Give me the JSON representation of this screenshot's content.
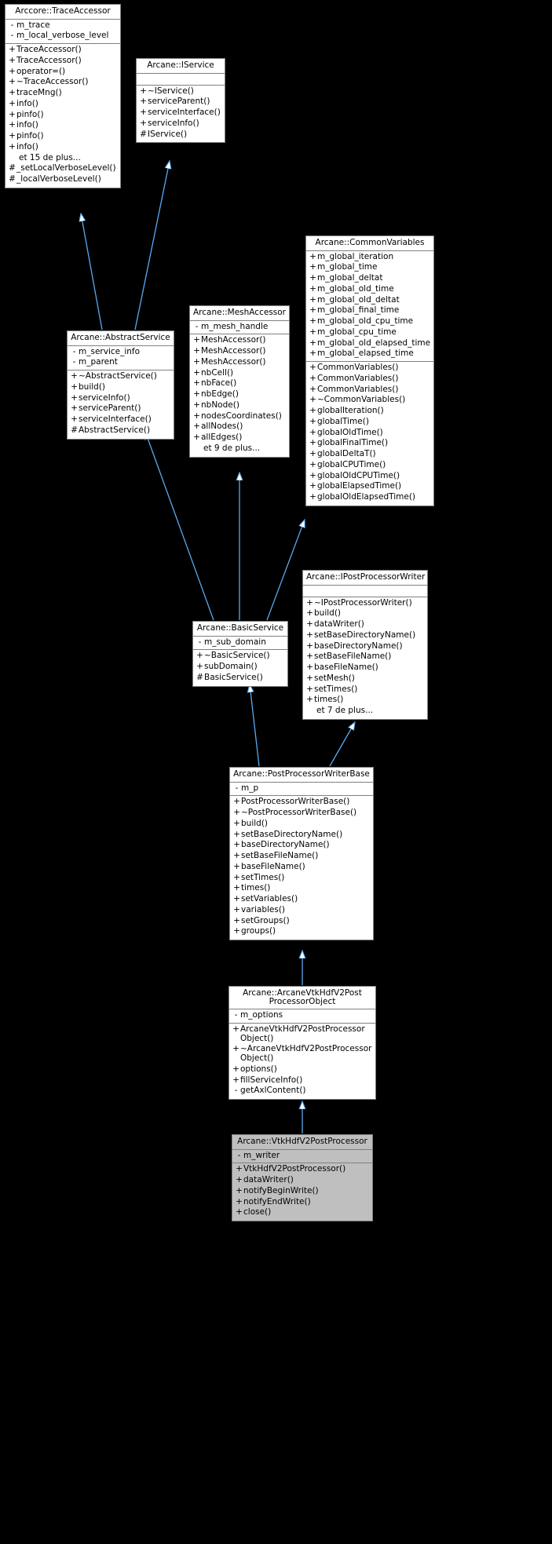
{
  "diagram": {
    "type": "uml-class-inheritance",
    "background": "#000000",
    "edge_color": "#5aaaf0",
    "class_box_fill": "#ffffff",
    "highlight_fill": "#bfbfbf",
    "classes": [
      {
        "id": "trace_accessor",
        "title": "Arccore::TraceAccessor",
        "highlight": false,
        "attributes": [
          {
            "vis": "-",
            "name": "m_trace"
          },
          {
            "vis": "-",
            "name": "m_local_verbose_level"
          }
        ],
        "operations": [
          {
            "vis": "+",
            "name": "TraceAccessor()"
          },
          {
            "vis": "+",
            "name": "TraceAccessor()"
          },
          {
            "vis": "+",
            "name": "operator=()"
          },
          {
            "vis": "+",
            "name": "~TraceAccessor()"
          },
          {
            "vis": "+",
            "name": "traceMng()"
          },
          {
            "vis": "+",
            "name": "info()"
          },
          {
            "vis": "+",
            "name": "pinfo()"
          },
          {
            "vis": "+",
            "name": "info()"
          },
          {
            "vis": "+",
            "name": "pinfo()"
          },
          {
            "vis": "+",
            "name": "info()"
          },
          {
            "vis": "",
            "name": "et 15 de plus..."
          },
          {
            "vis": "#",
            "name": "_setLocalVerboseLevel()"
          },
          {
            "vis": "#",
            "name": "_localVerboseLevel()"
          }
        ]
      },
      {
        "id": "iservice",
        "title": "Arcane::IService",
        "highlight": false,
        "attributes": [],
        "operations": [
          {
            "vis": "+",
            "name": "~IService()"
          },
          {
            "vis": "+",
            "name": "serviceParent()"
          },
          {
            "vis": "+",
            "name": "serviceInterface()"
          },
          {
            "vis": "+",
            "name": "serviceInfo()"
          },
          {
            "vis": "#",
            "name": "IService()"
          }
        ]
      },
      {
        "id": "common_variables",
        "title": "Arcane::CommonVariables",
        "highlight": false,
        "attributes": [
          {
            "vis": "+",
            "name": "m_global_iteration"
          },
          {
            "vis": "+",
            "name": "m_global_time"
          },
          {
            "vis": "+",
            "name": "m_global_deltat"
          },
          {
            "vis": "+",
            "name": "m_global_old_time"
          },
          {
            "vis": "+",
            "name": "m_global_old_deltat"
          },
          {
            "vis": "+",
            "name": "m_global_final_time"
          },
          {
            "vis": "+",
            "name": "m_global_old_cpu_time"
          },
          {
            "vis": "+",
            "name": "m_global_cpu_time"
          },
          {
            "vis": "+",
            "name": "m_global_old_elapsed_time"
          },
          {
            "vis": "+",
            "name": "m_global_elapsed_time"
          }
        ],
        "operations": [
          {
            "vis": "+",
            "name": "CommonVariables()"
          },
          {
            "vis": "+",
            "name": "CommonVariables()"
          },
          {
            "vis": "+",
            "name": "CommonVariables()"
          },
          {
            "vis": "+",
            "name": "~CommonVariables()"
          },
          {
            "vis": "+",
            "name": "globalIteration()"
          },
          {
            "vis": "+",
            "name": "globalTime()"
          },
          {
            "vis": "+",
            "name": "globalOldTime()"
          },
          {
            "vis": "+",
            "name": "globalFinalTime()"
          },
          {
            "vis": "+",
            "name": "globalDeltaT()"
          },
          {
            "vis": "+",
            "name": "globalCPUTime()"
          },
          {
            "vis": "+",
            "name": "globalOldCPUTime()"
          },
          {
            "vis": "+",
            "name": "globalElapsedTime()"
          },
          {
            "vis": "+",
            "name": "globalOldElapsedTime()"
          }
        ]
      },
      {
        "id": "abstract_service",
        "title": "Arcane::AbstractService",
        "highlight": false,
        "attributes": [
          {
            "vis": "-",
            "name": "m_service_info"
          },
          {
            "vis": "-",
            "name": "m_parent"
          }
        ],
        "operations": [
          {
            "vis": "+",
            "name": "~AbstractService()"
          },
          {
            "vis": "+",
            "name": "build()"
          },
          {
            "vis": "+",
            "name": "serviceInfo()"
          },
          {
            "vis": "+",
            "name": "serviceParent()"
          },
          {
            "vis": "+",
            "name": "serviceInterface()"
          },
          {
            "vis": "#",
            "name": "AbstractService()"
          }
        ]
      },
      {
        "id": "mesh_accessor",
        "title": "Arcane::MeshAccessor",
        "highlight": false,
        "attributes": [
          {
            "vis": "-",
            "name": "m_mesh_handle"
          }
        ],
        "operations": [
          {
            "vis": "+",
            "name": "MeshAccessor()"
          },
          {
            "vis": "+",
            "name": "MeshAccessor()"
          },
          {
            "vis": "+",
            "name": "MeshAccessor()"
          },
          {
            "vis": "+",
            "name": "nbCell()"
          },
          {
            "vis": "+",
            "name": "nbFace()"
          },
          {
            "vis": "+",
            "name": "nbEdge()"
          },
          {
            "vis": "+",
            "name": "nbNode()"
          },
          {
            "vis": "+",
            "name": "nodesCoordinates()"
          },
          {
            "vis": "+",
            "name": "allNodes()"
          },
          {
            "vis": "+",
            "name": "allEdges()"
          },
          {
            "vis": "",
            "name": "et 9 de plus..."
          }
        ]
      },
      {
        "id": "basic_service",
        "title": "Arcane::BasicService",
        "highlight": false,
        "attributes": [
          {
            "vis": "-",
            "name": "m_sub_domain"
          }
        ],
        "operations": [
          {
            "vis": "+",
            "name": "~BasicService()"
          },
          {
            "vis": "+",
            "name": "subDomain()"
          },
          {
            "vis": "#",
            "name": "BasicService()"
          }
        ]
      },
      {
        "id": "ipostprocessorwriter",
        "title": "Arcane::IPostProcessorWriter",
        "highlight": false,
        "attributes": [],
        "operations": [
          {
            "vis": "+",
            "name": "~IPostProcessorWriter()"
          },
          {
            "vis": "+",
            "name": "build()"
          },
          {
            "vis": "+",
            "name": "dataWriter()"
          },
          {
            "vis": "+",
            "name": "setBaseDirectoryName()"
          },
          {
            "vis": "+",
            "name": "baseDirectoryName()"
          },
          {
            "vis": "+",
            "name": "setBaseFileName()"
          },
          {
            "vis": "+",
            "name": "baseFileName()"
          },
          {
            "vis": "+",
            "name": "setMesh()"
          },
          {
            "vis": "+",
            "name": "setTimes()"
          },
          {
            "vis": "+",
            "name": "times()"
          },
          {
            "vis": "",
            "name": "et 7 de plus..."
          }
        ]
      },
      {
        "id": "postprocessorwriterbase",
        "title": "Arcane::PostProcessorWriterBase",
        "highlight": false,
        "attributes": [
          {
            "vis": "-",
            "name": "m_p"
          }
        ],
        "operations": [
          {
            "vis": "+",
            "name": "PostProcessorWriterBase()"
          },
          {
            "vis": "+",
            "name": "~PostProcessorWriterBase()"
          },
          {
            "vis": "+",
            "name": "build()"
          },
          {
            "vis": "+",
            "name": "setBaseDirectoryName()"
          },
          {
            "vis": "+",
            "name": "baseDirectoryName()"
          },
          {
            "vis": "+",
            "name": "setBaseFileName()"
          },
          {
            "vis": "+",
            "name": "baseFileName()"
          },
          {
            "vis": "+",
            "name": "setTimes()"
          },
          {
            "vis": "+",
            "name": "times()"
          },
          {
            "vis": "+",
            "name": "setVariables()"
          },
          {
            "vis": "+",
            "name": "variables()"
          },
          {
            "vis": "+",
            "name": "setGroups()"
          },
          {
            "vis": "+",
            "name": "groups()"
          }
        ]
      },
      {
        "id": "arcanevtkhdfv2postprocessorobject",
        "title": "Arcane::ArcaneVtkHdfV2Post\nProcessorObject",
        "highlight": false,
        "attributes": [
          {
            "vis": "-",
            "name": "m_options"
          }
        ],
        "operations": [
          {
            "vis": "+",
            "name": "ArcaneVtkHdfV2PostProcessor\nObject()"
          },
          {
            "vis": "+",
            "name": "~ArcaneVtkHdfV2PostProcessor\nObject()"
          },
          {
            "vis": "+",
            "name": "options()"
          },
          {
            "vis": "+",
            "name": "fillServiceInfo()"
          },
          {
            "vis": "-",
            "name": "getAxlContent()"
          }
        ]
      },
      {
        "id": "vtkhdfv2postprocessor",
        "title": "Arcane::VtkHdfV2PostProcessor",
        "highlight": true,
        "attributes": [
          {
            "vis": "-",
            "name": "m_writer"
          }
        ],
        "operations": [
          {
            "vis": "+",
            "name": "VtkHdfV2PostProcessor()"
          },
          {
            "vis": "+",
            "name": "dataWriter()"
          },
          {
            "vis": "+",
            "name": "notifyBeginWrite()"
          },
          {
            "vis": "+",
            "name": "notifyEndWrite()"
          },
          {
            "vis": "+",
            "name": "close()"
          }
        ]
      }
    ],
    "edges": [
      {
        "from": "abstract_service",
        "to": "trace_accessor",
        "kind": "inheritance"
      },
      {
        "from": "abstract_service",
        "to": "iservice",
        "kind": "inheritance"
      },
      {
        "from": "basic_service",
        "to": "abstract_service",
        "kind": "inheritance"
      },
      {
        "from": "basic_service",
        "to": "mesh_accessor",
        "kind": "inheritance"
      },
      {
        "from": "basic_service",
        "to": "common_variables",
        "kind": "inheritance"
      },
      {
        "from": "postprocessorwriterbase",
        "to": "basic_service",
        "kind": "inheritance"
      },
      {
        "from": "postprocessorwriterbase",
        "to": "ipostprocessorwriter",
        "kind": "inheritance"
      },
      {
        "from": "arcanevtkhdfv2postprocessorobject",
        "to": "postprocessorwriterbase",
        "kind": "inheritance"
      },
      {
        "from": "vtkhdfv2postprocessor",
        "to": "arcanevtkhdfv2postprocessorobject",
        "kind": "inheritance"
      }
    ]
  }
}
